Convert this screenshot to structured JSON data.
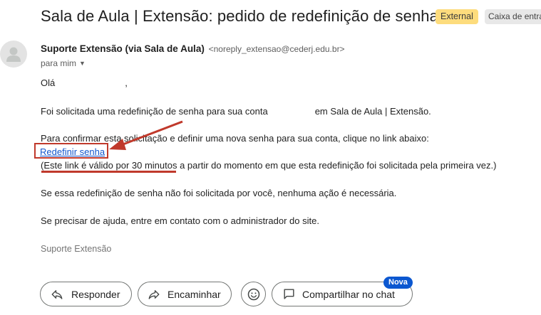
{
  "email": {
    "subject": "Sala de Aula | Extensão: pedido de redefinição de senha",
    "labels": {
      "external": "External",
      "inbox": "Caixa de entra"
    },
    "sender": {
      "name": "Suporte Extensão (via Sala de Aula)",
      "address": "<noreply_extensao@cederj.edu.br>"
    },
    "recipient_line": "para mim",
    "body": {
      "greeting_start": "Olá",
      "greeting_end": ",",
      "para1_start": "Foi solicitada uma redefinição de senha para sua conta",
      "para1_end": "em Sala de Aula | Extensão.",
      "para2": "Para confirmar esta solicitação e definir uma nova senha para sua conta, clique no link abaixo:",
      "link_text": "Redefinir senha",
      "validity_note": "(Este link é válido por 30 minutos a partir do momento em que esta redefinição foi solicitada pela primeira vez.)",
      "para3": "Se essa redefinição de senha não foi solicitada por você, nenhuma ação é necessária.",
      "para4": "Se precisar de ajuda, entre em contato com o administrador do site.",
      "signature": "Suporte Extensão"
    }
  },
  "actions": {
    "reply": "Responder",
    "forward": "Encaminhar",
    "share_chat": "Compartilhar no chat",
    "new_badge": "Nova"
  },
  "colors": {
    "annotation": "#c0392b",
    "link": "#1155cc",
    "external_chip": "#fddc7d",
    "badge": "#0b57d0"
  }
}
